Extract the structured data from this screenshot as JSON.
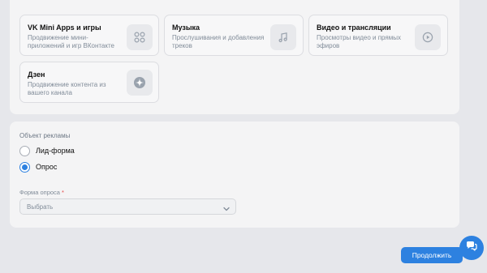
{
  "cards": [
    {
      "title": "VK Mini Apps и игры",
      "desc": "Продвижение мини-приложений и игр ВКонтакте",
      "icon": "grid-icon"
    },
    {
      "title": "Музыка",
      "desc": "Прослушивания и добавления треков",
      "icon": "music-note-icon"
    },
    {
      "title": "Видео и трансляции",
      "desc": "Просмотры видео и прямых эфиров",
      "icon": "play-icon"
    },
    {
      "title": "Дзен",
      "desc": "Продвижение контента из вашего канала",
      "icon": "zen-icon"
    }
  ],
  "ad_object": {
    "label": "Объект рекламы",
    "options": [
      {
        "label": "Лид-форма",
        "selected": false
      },
      {
        "label": "Опрос",
        "selected": true
      }
    ]
  },
  "survey_form": {
    "label": "Форма опроса",
    "required_mark": "*",
    "value": "Выбрать"
  },
  "continue_label": "Продолжить",
  "colors": {
    "accent": "#2d81e0",
    "background": "#e6e7eb",
    "panel": "#f4f4f5"
  }
}
